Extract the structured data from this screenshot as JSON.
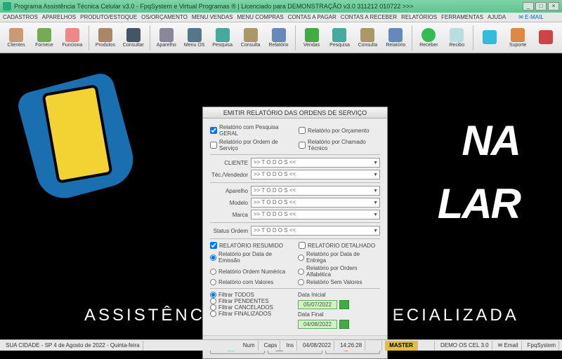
{
  "titlebar": {
    "text": "Programa Assistência Técnica Celular v3.0 - FpqSystem e Virtual Programas ® | Licenciado para DEMONSTRAÇÃO v3.0 311212 010722 >>>"
  },
  "menubar": {
    "items": [
      "CADASTROS",
      "APARELHOS",
      "PRODUTO/ESTOQUE",
      "OS/ORÇAMENTO",
      "MENU VENDAS",
      "MENU COMPRAS",
      "CONTAS A PAGAR",
      "CONTAS A RECEBER",
      "RELATÓRIOS",
      "FERRAMENTAS",
      "AJUDA"
    ],
    "email": "E-MAIL"
  },
  "toolbar": {
    "buttons": [
      {
        "label": "Clientes",
        "color": "#c97"
      },
      {
        "label": "Fornece",
        "color": "#7a5"
      },
      {
        "label": "Funciona",
        "color": "#e88"
      },
      {
        "label": "Produtos",
        "color": "#a86"
      },
      {
        "label": "Consultar",
        "color": "#456"
      },
      {
        "label": "Aparelho",
        "color": "#889"
      },
      {
        "label": "Menu OS",
        "color": "#578"
      },
      {
        "label": "Pesquisa",
        "color": "#4a9"
      },
      {
        "label": "Consulta",
        "color": "#a96"
      },
      {
        "label": "Relatório",
        "color": "#68b"
      },
      {
        "label": "Vendas",
        "color": "#4a4"
      },
      {
        "label": "Pesquisa",
        "color": "#4a9"
      },
      {
        "label": "Consulta",
        "color": "#a96"
      },
      {
        "label": "Relatório",
        "color": "#68b"
      },
      {
        "label": "Receber",
        "color": "#3b5"
      },
      {
        "label": "Recibo",
        "color": "#bdd"
      },
      {
        "label": "",
        "color": "#3bd"
      },
      {
        "label": "Suporte",
        "color": "#d84"
      },
      {
        "label": "",
        "color": "#c44"
      }
    ]
  },
  "logo": {
    "big1": "NA",
    "big2": "LAR",
    "sub_left": "ASSISTÊNC",
    "sub_right": "ECIALIZADA"
  },
  "dialog": {
    "title": "EMITIR RELATÓRIO DAS ORDENS DE SERVIÇO",
    "chk_geral": "Relatório com Pesquisa GERAL",
    "chk_orcamento": "Relatório por Orçamento",
    "chk_ordem": "Relatório por Ordem de Serviço",
    "chk_chamado": "Relatório por Chamado Técnico",
    "lbl_cliente": "CLIENTE",
    "lbl_tec": "Téc./Vendedor",
    "lbl_aparelho": "Aparelho",
    "lbl_modelo": "Modelo",
    "lbl_marca": "Marca",
    "lbl_status": "Status Ordem",
    "todos": ">> T O D O S <<",
    "chk_resumido": "RELATÓRIO RESUMIDO",
    "chk_detalhado": "RELATÓRIO DETALHADO",
    "rad_emissao": "Relatório por Data de Emissão",
    "rad_entrega": "Relatório por Data de Entrega",
    "rad_numerica": "Relatório Ordem Numérica",
    "rad_alfabetica": "Relatório por Ordem Alfabética",
    "rad_comvalores": "Relatório com Valores",
    "rad_semvalores": "Relatório Sem Valores",
    "filt_todos": "Filtrar TODOS",
    "filt_pendentes": "Filtrar PENDENTES",
    "filt_cancelados": "Filtrar CANCELADOS",
    "filt_finalizados": "Filtrar FINALIZADOS",
    "data_inicial_lbl": "Data Inicial",
    "data_inicial": "05/07/2022",
    "data_final_lbl": "Data Final",
    "data_final": "04/08/2022",
    "btn_tela": "Tela",
    "btn_impressora": "Impressora",
    "btn_sair": "Sair"
  },
  "statusbar": {
    "left": "SUA CIDADE - SP  4 de Agosto de 2022 - Quinta-feira",
    "num": "Num",
    "caps": "Caps",
    "ins": "Ins",
    "date": "04/08/2022",
    "time": "14:26:28",
    "master": "MASTER",
    "demo": "DEMO OS CEL 3.0",
    "email": "Email",
    "fpq": "FpqSystem"
  }
}
